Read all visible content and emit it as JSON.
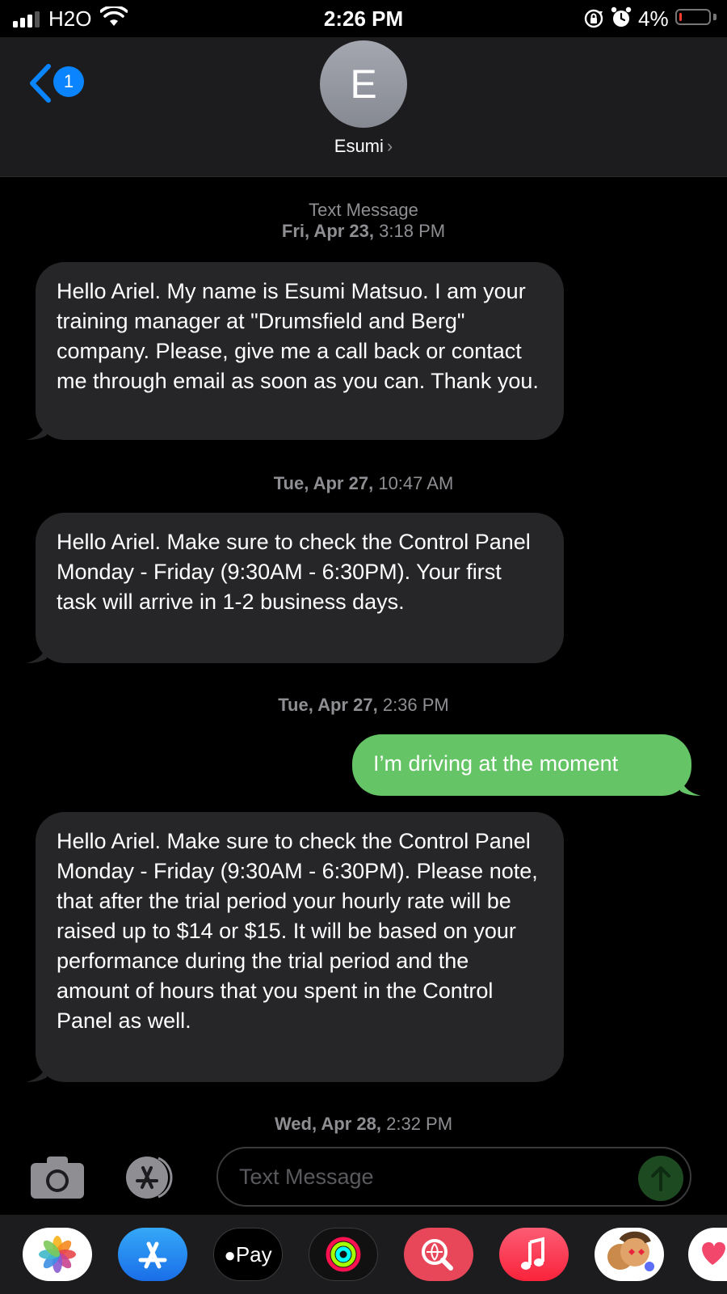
{
  "status_bar": {
    "carrier": "H2O",
    "time": "2:26 PM",
    "battery_percent": "4%",
    "battery_level": 0.04,
    "signal_bars": 3,
    "icons": [
      "signal-icon",
      "wifi-icon",
      "orientation-lock-icon",
      "alarm-icon",
      "battery-icon"
    ]
  },
  "header": {
    "back_badge_count": "1",
    "avatar_initial": "E",
    "contact_name": "Esumi",
    "chevron": "›",
    "icons": [
      "back-chevron-icon",
      "chevron-right-icon"
    ]
  },
  "conversation": {
    "service_label": "Text Message",
    "items": [
      {
        "type": "timestamp",
        "day": "Fri, Apr 23,",
        "time": "3:18 PM"
      },
      {
        "type": "incoming",
        "text": "Hello Ariel. My name is Esumi Matsuo. I am your training manager at \"Drumsfield and Berg\" company. Please, give me a call back or contact me through email as soon as you can. Thank you."
      },
      {
        "type": "timestamp",
        "day": "Tue, Apr 27,",
        "time": "10:47 AM"
      },
      {
        "type": "incoming",
        "text": "Hello Ariel. Make sure to check the Control Panel Monday - Friday (9:30AM - 6:30PM). Your first task will arrive in 1-2 business days."
      },
      {
        "type": "timestamp",
        "day": "Tue, Apr 27,",
        "time": "2:36 PM"
      },
      {
        "type": "outgoing",
        "text": "I’m driving at the moment"
      },
      {
        "type": "incoming",
        "text": "Hello Ariel. Make sure to check the Control Panel Monday - Friday (9:30AM - 6:30PM). Please note, that after the trial period your hourly rate will be raised up to $14 or $15. It will be based on your performance during the trial period and the amount of hours that you spent in the Control Panel as well."
      },
      {
        "type": "timestamp",
        "day": "Wed, Apr 28,",
        "time": "2:32 PM"
      }
    ]
  },
  "input_bar": {
    "placeholder": "Text Message",
    "icons": [
      "camera-icon",
      "app-store-icon",
      "send-arrow-icon"
    ]
  },
  "app_drawer": {
    "apps": [
      {
        "name": "photos-app-icon"
      },
      {
        "name": "app-store-app-icon"
      },
      {
        "name": "apple-pay-app-icon",
        "label": "Pay"
      },
      {
        "name": "activity-app-icon"
      },
      {
        "name": "images-search-app-icon"
      },
      {
        "name": "music-app-icon"
      },
      {
        "name": "memoji-app-icon"
      },
      {
        "name": "digital-touch-app-icon"
      }
    ]
  },
  "colors": {
    "header_bg": "#1c1c1e",
    "incoming_bubble": "#262628",
    "outgoing_bubble": "#65c466",
    "accent": "#0a84ff",
    "battery_low": "#ff3b30"
  }
}
